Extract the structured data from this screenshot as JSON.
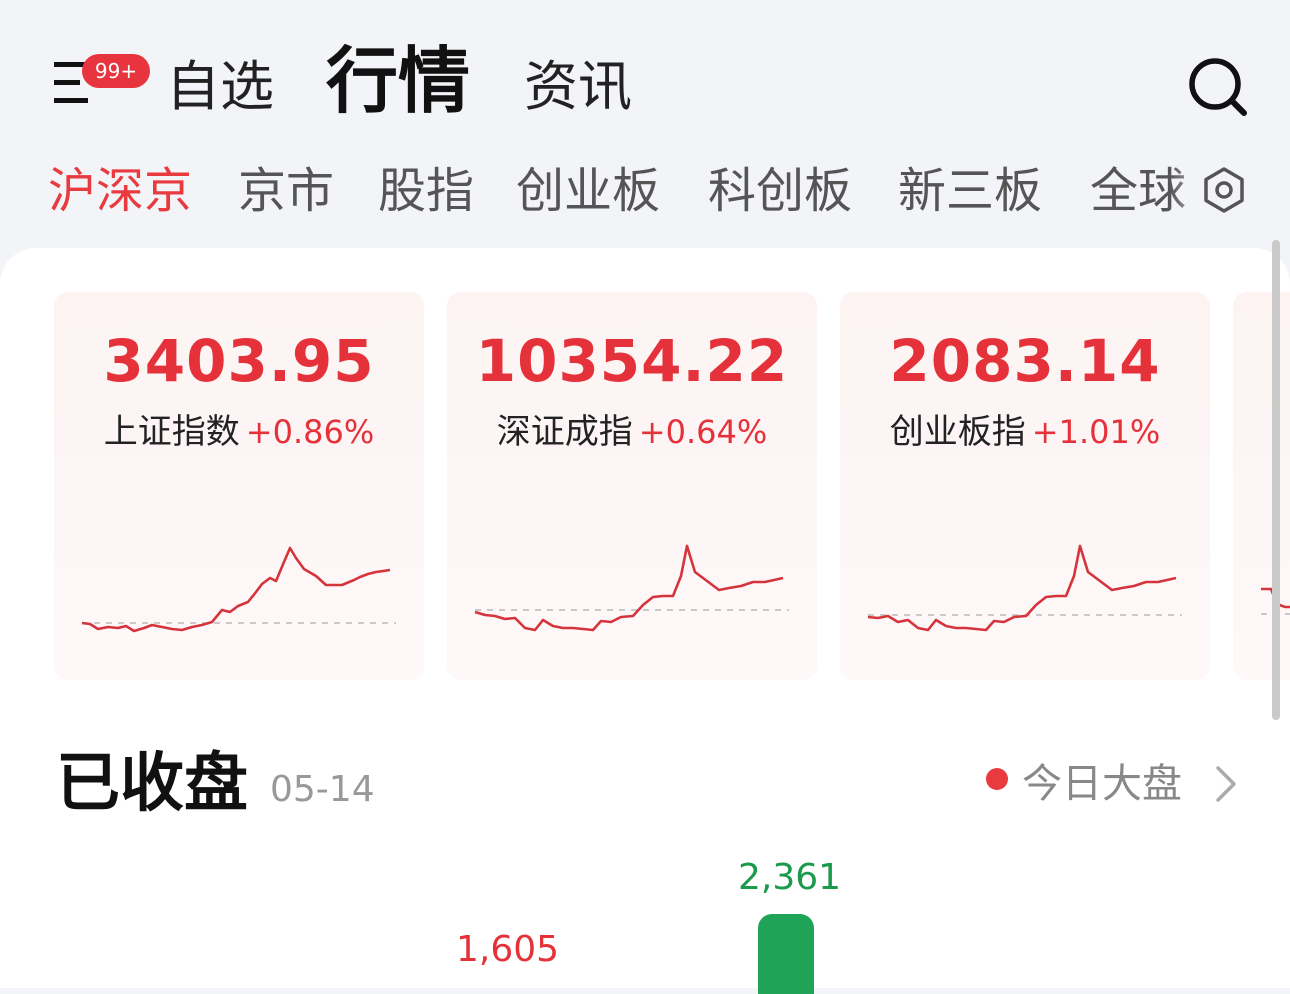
{
  "nav": {
    "badge": "99+",
    "tabs": [
      "自选",
      "行情",
      "资讯"
    ],
    "active_tab": "行情"
  },
  "sub_tabs": {
    "items": [
      "沪深京",
      "京市",
      "股指",
      "创业板",
      "科创板",
      "新三板",
      "全球"
    ],
    "active": "沪深京"
  },
  "index_cards": [
    {
      "value": "3403.95",
      "name": "上证指数",
      "change": "+0.86%"
    },
    {
      "value": "10354.22",
      "name": "深证成指",
      "change": "+0.64%"
    },
    {
      "value": "2083.14",
      "name": "创业板指",
      "change": "+1.01%"
    }
  ],
  "market_status": {
    "title": "已收盘",
    "date": "05-14",
    "link_label": "今日大盘"
  },
  "breadth": {
    "up_count": "1,605",
    "down_count": "2,361"
  },
  "colors": {
    "up": "#e5323a",
    "down": "#1fa357",
    "accent": "#e83a3f"
  }
}
